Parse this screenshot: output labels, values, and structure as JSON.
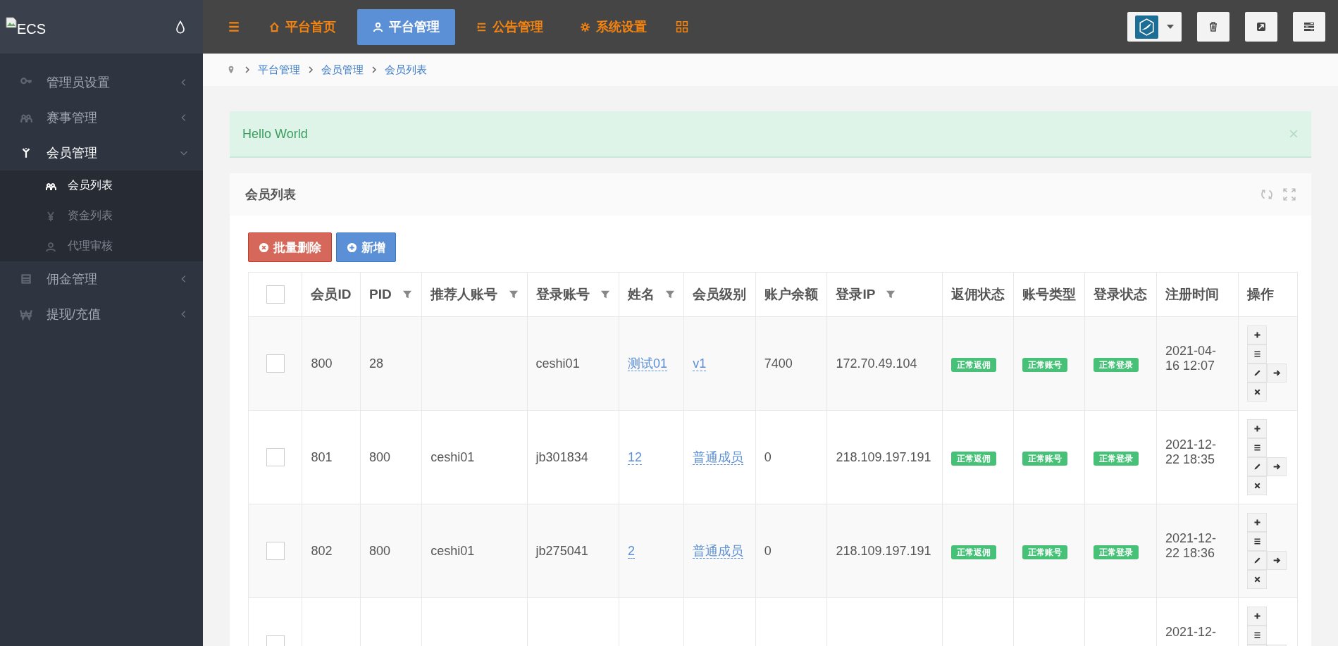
{
  "logo": {
    "alt": "ECS"
  },
  "nav": {
    "items": [
      {
        "label": "平台首页",
        "selected": false
      },
      {
        "label": "平台管理",
        "selected": true
      },
      {
        "label": "公告管理",
        "selected": false
      },
      {
        "label": "系统设置",
        "selected": false
      }
    ]
  },
  "sidebar": {
    "items": [
      {
        "label": "管理员设置",
        "expanded": false
      },
      {
        "label": "赛事管理",
        "expanded": false
      },
      {
        "label": "会员管理",
        "expanded": true,
        "children": [
          {
            "label": "会员列表",
            "selected": true
          },
          {
            "label": "资金列表",
            "selected": false
          },
          {
            "label": "代理审核",
            "selected": false
          }
        ]
      },
      {
        "label": "佣金管理",
        "expanded": false
      },
      {
        "label": "提现/充值",
        "expanded": false
      }
    ]
  },
  "breadcrumb": [
    "平台管理",
    "会员管理",
    "会员列表"
  ],
  "alert": {
    "text": "Hello World",
    "close": "×"
  },
  "card": {
    "title": "会员列表"
  },
  "buttons": [
    {
      "kind": "danger",
      "label": "批量删除"
    },
    {
      "kind": "primary",
      "label": "新增"
    }
  ],
  "table": {
    "columns": [
      {
        "kind": "check",
        "checked": false
      },
      {
        "label": "会员ID",
        "filter": false
      },
      {
        "label": "PID",
        "filter": true
      },
      {
        "label": "推荐人账号",
        "filter": true
      },
      {
        "label": "登录账号",
        "filter": true
      },
      {
        "label": "姓名",
        "filter": true
      },
      {
        "label": "会员级别",
        "filter": false
      },
      {
        "label": "账户余额",
        "filter": false
      },
      {
        "label": "登录IP",
        "filter": true
      },
      {
        "label": "返佣状态",
        "filter": false
      },
      {
        "label": "账号类型",
        "filter": false
      },
      {
        "label": "登录状态",
        "filter": false
      },
      {
        "label": "注册时间",
        "filter": false
      },
      {
        "label": "操作",
        "filter": false
      }
    ],
    "rows": [
      {
        "checked": false,
        "id": "800",
        "pid": "28",
        "referrer": "",
        "account": "ceshi01",
        "name": "测试01",
        "level": "v1",
        "balance": "7400",
        "ip": "172.70.49.104",
        "rebate": "正常返佣",
        "account_type": "正常账号",
        "login_status": "正常登录",
        "registered": "2021-04-16 12:07"
      },
      {
        "checked": false,
        "id": "801",
        "pid": "800",
        "referrer": "ceshi01",
        "account": "jb301834",
        "name": "12",
        "level": "普通成员",
        "balance": "0",
        "ip": "218.109.197.191",
        "rebate": "正常返佣",
        "account_type": "正常账号",
        "login_status": "正常登录",
        "registered": "2021-12-22 18:35"
      },
      {
        "checked": false,
        "id": "802",
        "pid": "800",
        "referrer": "ceshi01",
        "account": "jb275041",
        "name": "2",
        "level": "普通成员",
        "balance": "0",
        "ip": "218.109.197.191",
        "rebate": "正常返佣",
        "account_type": "正常账号",
        "login_status": "正常登录",
        "registered": "2021-12-22 18:36"
      },
      {
        "checked": false,
        "registered": "2021-12-"
      }
    ]
  }
}
